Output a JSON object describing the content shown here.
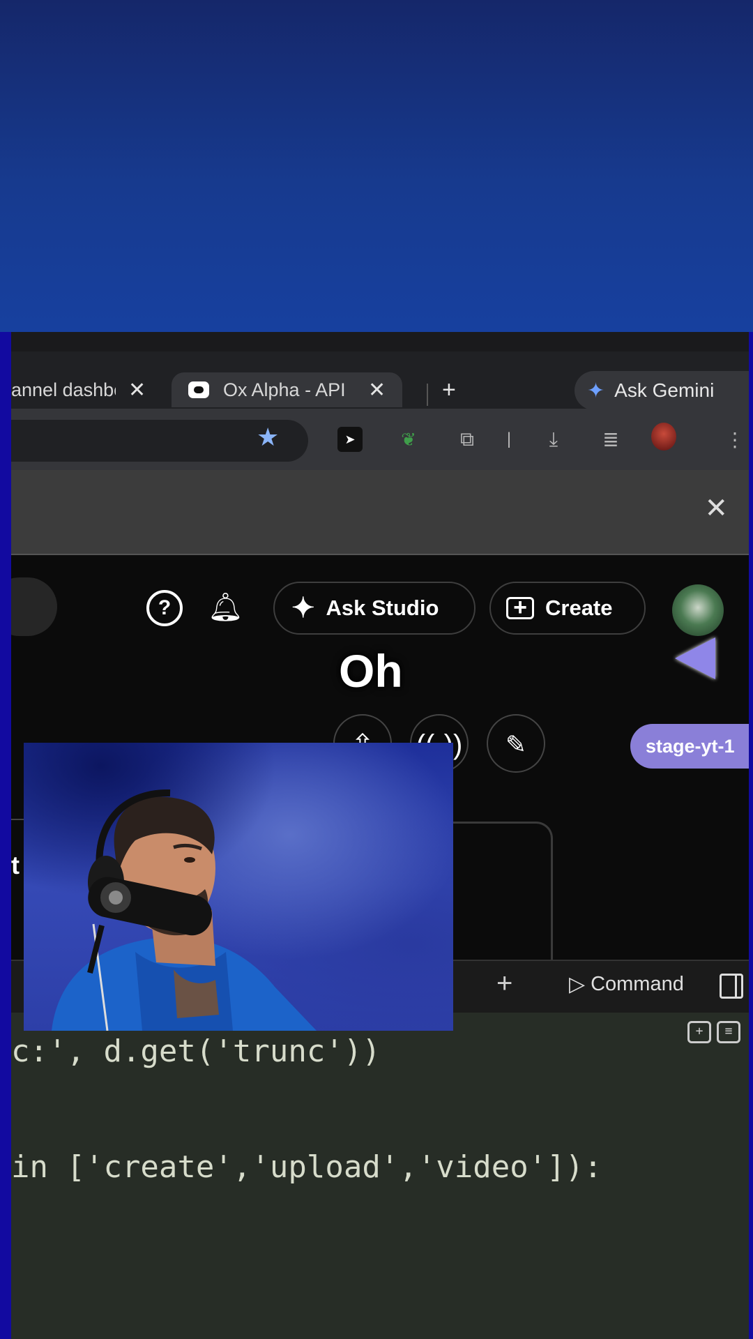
{
  "browser": {
    "tabs": [
      {
        "label": "annel dashbo",
        "close": "✕"
      },
      {
        "label": "Ox Alpha - API",
        "close": "✕",
        "active": true
      }
    ],
    "new_tab": "+",
    "ask_gemini": "Ask Gemini",
    "infobar_close": "✕"
  },
  "studio": {
    "ask_studio": "Ask Studio",
    "create": "Create",
    "caption": "Oh",
    "stage_badge": "stage-yt-1",
    "side_text": "t"
  },
  "codebar": {
    "add": "+",
    "command": "Command"
  },
  "code": {
    "line1": "c:', d.get('trunc'))",
    "line2": "in ['create','upload','video']):"
  },
  "colors": {
    "page_border": "#120aa0",
    "top_gradient": "#173a8e",
    "stage_badge": "#8a7fd8",
    "code_bg": "#272d26"
  }
}
